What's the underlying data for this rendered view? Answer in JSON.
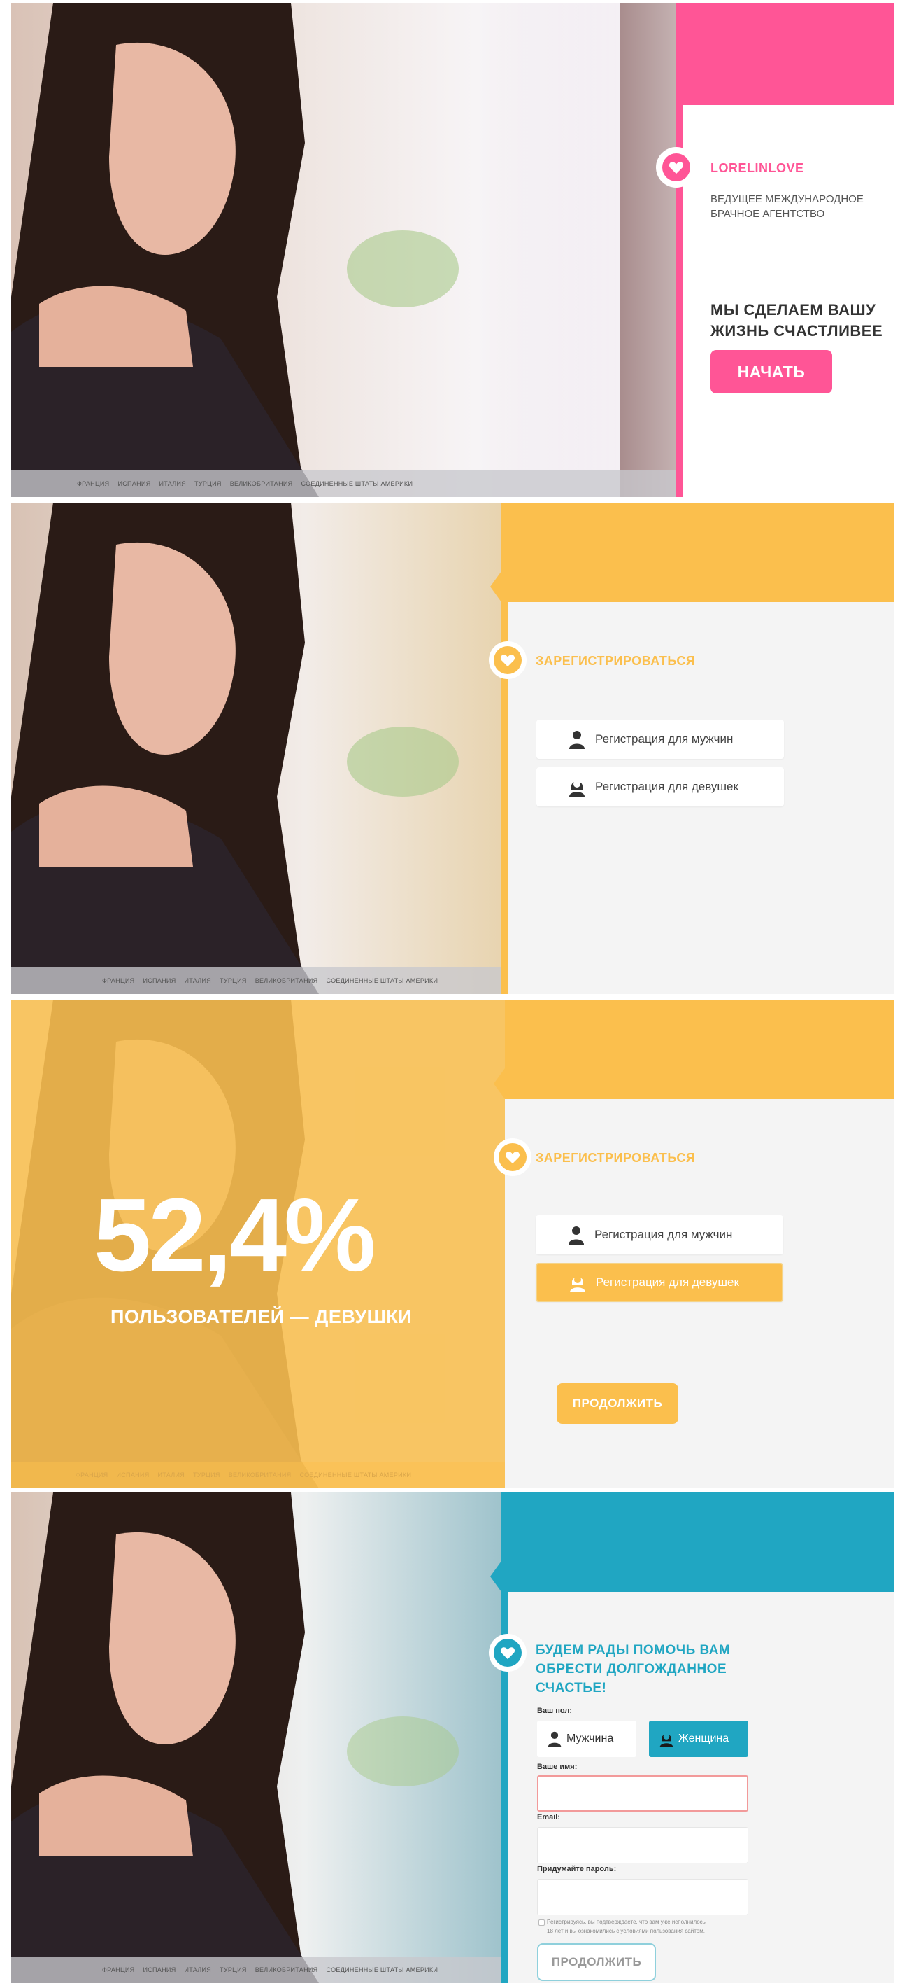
{
  "countries": [
    "ФРАНЦИЯ",
    "ИСПАНИЯ",
    "ИТАЛИЯ",
    "ТУРЦИЯ",
    "ВЕЛИКОБРИТАНИЯ",
    "СОЕДИНЕННЫЕ ШТАТЫ АМЕРИКИ"
  ],
  "colors": {
    "pink": "#ff5596",
    "yellow": "#fbbf4d",
    "teal": "#20a6c2",
    "light": "#f4f4f4"
  },
  "panel1": {
    "brand": "LORELINLOVE",
    "tagline_line1": "ВЕДУЩЕЕ МЕЖДУНАРОДНОЕ",
    "tagline_line2": "БРАЧНОЕ АГЕНТСТВО",
    "headline_line1": "МЫ СДЕЛАЕМ ВАШУ",
    "headline_line2": "ЖИЗНЬ СЧАСТЛИВЕЕ",
    "cta": "НАЧАТЬ"
  },
  "panel2": {
    "title": "ЗАРЕГИСТРИРОВАТЬСЯ",
    "men_button": "Регистрация для мужчин",
    "women_button": "Регистрация для девушек"
  },
  "panel3": {
    "stat": "52,4%",
    "stat_caption": "ПОЛЬЗОВАТЕЛЕЙ — ДЕВУШКИ",
    "title": "ЗАРЕГИСТРИРОВАТЬСЯ",
    "men_button": "Регистрация для мужчин",
    "women_button": "Регистрация для девушек",
    "continue": "ПРОДОЛЖИТЬ"
  },
  "panel4": {
    "title_line1": "БУДЕМ РАДЫ ПОМОЧЬ ВАМ",
    "title_line2": "ОБРЕСТИ ДОЛГОЖДАННОЕ",
    "title_line3": "СЧАСТЬЕ!",
    "gender_label": "Ваш пол:",
    "male": "Мужчина",
    "female": "Женщина",
    "name_label": "Ваше имя:",
    "email_label": "Email:",
    "password_label": "Придумайте пароль:",
    "terms_line1": "Регистрируясь, вы подтверждаете, что вам уже исполнилось",
    "terms_line2": "18 лет и вы ознакомились с условиями пользования сайтом.",
    "continue": "ПРОДОЛЖИТЬ"
  }
}
